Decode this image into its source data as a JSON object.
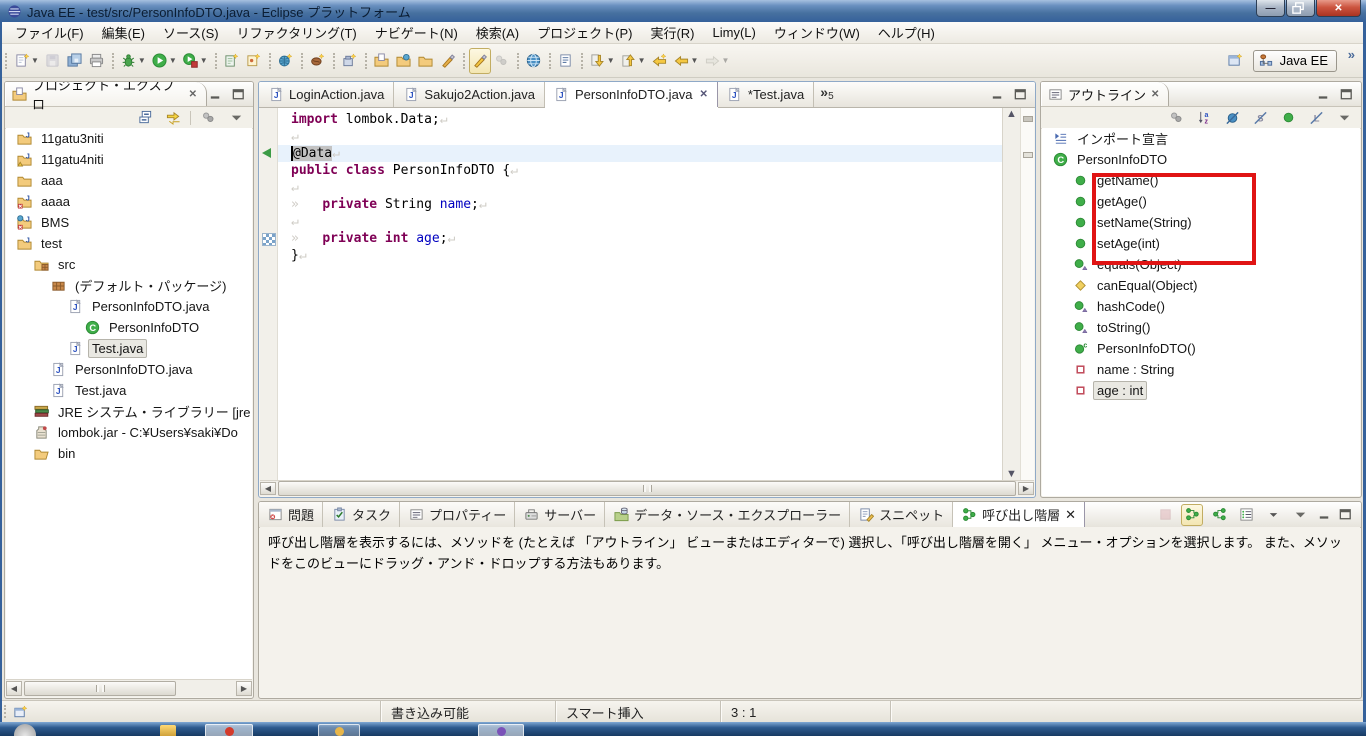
{
  "colors": {
    "annotation_red": "#e01414",
    "keyword": "#7f0055",
    "field_blue": "#0000c0",
    "current_line": "#e8f2fc",
    "selection_grey": "#c3c3c3"
  },
  "window": {
    "title": "Java EE - test/src/PersonInfoDTO.java - Eclipse プラットフォーム",
    "minimize": "—",
    "close": "x"
  },
  "menu": {
    "items": [
      "ファイル(F)",
      "編集(E)",
      "ソース(S)",
      "リファクタリング(T)",
      "ナビゲート(N)",
      "検索(A)",
      "プロジェクト(P)",
      "実行(R)",
      "Limy(L)",
      "ウィンドウ(W)",
      "ヘルプ(H)"
    ]
  },
  "toolbar": {
    "groups": [
      [
        {
          "name": "new-wizard",
          "icon": "new",
          "dd": true
        },
        {
          "name": "save",
          "icon": "save",
          "disabled": true
        },
        {
          "name": "save-all",
          "icon": "save-all"
        },
        {
          "name": "print",
          "icon": "print"
        }
      ],
      [
        {
          "name": "debug",
          "icon": "debug",
          "dd": true
        },
        {
          "name": "run",
          "icon": "run",
          "dd": true
        },
        {
          "name": "run-external-tools",
          "icon": "run-ext",
          "dd": true
        }
      ],
      [
        {
          "name": "new-servlet",
          "icon": "wiz-file"
        },
        {
          "name": "new-jsp",
          "icon": "wiz-page"
        }
      ],
      [
        {
          "name": "new-web-service",
          "icon": "wiz-globe"
        }
      ],
      [
        {
          "name": "new-ejb",
          "icon": "wiz-bean"
        }
      ],
      [
        {
          "name": "new-connector",
          "icon": "wiz-box"
        }
      ],
      [
        {
          "name": "open-type",
          "icon": "folder-doc"
        },
        {
          "name": "open-resource",
          "icon": "folder-globe"
        },
        {
          "name": "open-plugin",
          "icon": "folder-plain"
        },
        {
          "name": "format",
          "icon": "brush"
        }
      ],
      [
        {
          "name": "mark-occurrences",
          "icon": "highlighter",
          "toggled": true
        },
        {
          "name": "occurrence-filter",
          "icon": "dots",
          "disabled": true
        }
      ],
      [
        {
          "name": "web-browser",
          "icon": "globe"
        }
      ],
      [
        {
          "name": "task-list",
          "icon": "notes"
        }
      ],
      [
        {
          "name": "next-annotation",
          "icon": "arrow-down",
          "dd": true
        },
        {
          "name": "prev-annotation",
          "icon": "arrow-up",
          "dd": true
        },
        {
          "name": "last-edit-location",
          "icon": "back-star"
        },
        {
          "name": "back",
          "icon": "back",
          "dd": true
        },
        {
          "name": "forward",
          "icon": "forward",
          "disabled": true,
          "dd": true
        }
      ]
    ],
    "perspective": {
      "open_icon": "persp-open",
      "buttons": [
        {
          "icon": "persp-javaee",
          "label": "Java EE",
          "selected": true
        }
      ],
      "overflow": "»"
    }
  },
  "project_explorer": {
    "title": "プロジェクト・エクスプロ",
    "tools": [
      {
        "name": "collapse-all",
        "icon": "collapse-all"
      },
      {
        "name": "link-with-editor",
        "icon": "link-editor"
      },
      {
        "name": "sep",
        "icon": "sep"
      },
      {
        "name": "customize-view",
        "icon": "dots"
      },
      {
        "name": "view-menu",
        "icon": "viewmenu"
      }
    ],
    "items": [
      {
        "lvl": 0,
        "icon": "proj-j",
        "label": "11gatu3niti"
      },
      {
        "lvl": 0,
        "icon": "proj-warn",
        "label": "11gatu4niti"
      },
      {
        "lvl": 0,
        "icon": "folder",
        "label": "aaa"
      },
      {
        "lvl": 0,
        "icon": "proj-err",
        "label": "aaaa"
      },
      {
        "lvl": 0,
        "icon": "proj-bms",
        "label": "BMS"
      },
      {
        "lvl": 0,
        "icon": "proj-j",
        "label": "test"
      },
      {
        "lvl": 1,
        "icon": "src",
        "label": "src"
      },
      {
        "lvl": 2,
        "icon": "pkg",
        "label": "(デフォルト・パッケージ)"
      },
      {
        "lvl": 3,
        "icon": "jfile",
        "label": "PersonInfoDTO.java"
      },
      {
        "lvl": 4,
        "icon": "class",
        "label": "PersonInfoDTO"
      },
      {
        "lvl": 3,
        "icon": "jfile",
        "label": "Test.java",
        "selected": true
      },
      {
        "lvl": 2,
        "icon": "jfile",
        "label": "PersonInfoDTO.java"
      },
      {
        "lvl": 2,
        "icon": "jfile",
        "label": "Test.java"
      },
      {
        "lvl": 1,
        "icon": "lib",
        "label": "JRE システム・ライブラリー [jre"
      },
      {
        "lvl": 1,
        "icon": "jar",
        "label": "lombok.jar - C:¥Users¥saki¥Do"
      },
      {
        "lvl": 1,
        "icon": "folder-open",
        "label": "bin"
      }
    ]
  },
  "editor": {
    "tabs": [
      {
        "icon": "jfile",
        "label": "LoginAction.java"
      },
      {
        "icon": "jfile",
        "label": "Sakujo2Action.java"
      },
      {
        "icon": "jfile",
        "label": "PersonInfoDTO.java",
        "active": true,
        "closable": true
      },
      {
        "icon": "jfile",
        "label": "*Test.java"
      }
    ],
    "overflow": {
      "chevron": "»",
      "count": "5"
    },
    "code_lines": [
      {
        "segs": [
          {
            "t": "import ",
            "c": "kw"
          },
          {
            "t": "lombok.Data;",
            "c": "pl"
          },
          {
            "t": "↵",
            "c": "ws"
          }
        ]
      },
      {
        "segs": [
          {
            "t": "↵",
            "c": "ws"
          }
        ]
      },
      {
        "current": true,
        "segs": [
          {
            "t": "@Data",
            "c": "sel"
          },
          {
            "t": "↵",
            "c": "ws"
          }
        ]
      },
      {
        "segs": [
          {
            "t": "public class ",
            "c": "kw"
          },
          {
            "t": "PersonInfoDTO {",
            "c": "pl"
          },
          {
            "t": "↵",
            "c": "ws"
          }
        ]
      },
      {
        "segs": [
          {
            "t": "↵",
            "c": "ws"
          }
        ]
      },
      {
        "segs": [
          {
            "t": "»   ",
            "c": "ws"
          },
          {
            "t": "private ",
            "c": "kw"
          },
          {
            "t": "String ",
            "c": "pl"
          },
          {
            "t": "name",
            "c": "fl"
          },
          {
            "t": ";",
            "c": "pl"
          },
          {
            "t": "↵",
            "c": "ws"
          }
        ]
      },
      {
        "segs": [
          {
            "t": "↵",
            "c": "ws"
          }
        ]
      },
      {
        "segs": [
          {
            "t": "»   ",
            "c": "ws"
          },
          {
            "t": "private int ",
            "c": "kw"
          },
          {
            "t": "age",
            "c": "fl"
          },
          {
            "t": ";",
            "c": "pl"
          },
          {
            "t": "↵",
            "c": "ws"
          }
        ]
      },
      {
        "segs": [
          {
            "t": "}",
            "c": "pl"
          },
          {
            "t": "↵",
            "c": "ws"
          }
        ]
      }
    ],
    "gutter_markers": [
      {
        "line": 2,
        "type": "triangle"
      },
      {
        "line": 7,
        "type": "checker"
      }
    ]
  },
  "outline": {
    "title": "アウトライン",
    "tools": [
      {
        "name": "focus",
        "icon": "dots"
      },
      {
        "name": "sort",
        "icon": "sort-az"
      },
      {
        "name": "hide-fields",
        "icon": "hide-fields"
      },
      {
        "name": "hide-static",
        "icon": "hide-static"
      },
      {
        "name": "hide-non-public",
        "icon": "hide-nonpublic"
      },
      {
        "name": "hide-local-types",
        "icon": "hide-local"
      },
      {
        "name": "view-menu",
        "icon": "viewmenu"
      }
    ],
    "items": [
      {
        "lvl": 0,
        "icon": "imports",
        "label": "インポート宣言"
      },
      {
        "lvl": 0,
        "icon": "class",
        "label": "PersonInfoDTO"
      },
      {
        "lvl": 1,
        "icon": "pub",
        "label": "getName()"
      },
      {
        "lvl": 1,
        "icon": "pub",
        "label": "getAge()"
      },
      {
        "lvl": 1,
        "icon": "pub",
        "label": "setName(String)"
      },
      {
        "lvl": 1,
        "icon": "pub",
        "label": "setAge(int)"
      },
      {
        "lvl": 1,
        "icon": "pub-ovr",
        "label": "equals(Object)"
      },
      {
        "lvl": 1,
        "icon": "pro",
        "label": "canEqual(Object)"
      },
      {
        "lvl": 1,
        "icon": "pub-ovr",
        "label": "hashCode()"
      },
      {
        "lvl": 1,
        "icon": "pub-ovr",
        "label": "toString()"
      },
      {
        "lvl": 1,
        "icon": "ctor",
        "label": "PersonInfoDTO()"
      },
      {
        "lvl": 1,
        "icon": "pri-field",
        "label": "name : String"
      },
      {
        "lvl": 1,
        "icon": "pri-field",
        "label": "age : int",
        "selected": true
      }
    ]
  },
  "bottom_panel": {
    "tabs": [
      {
        "icon": "problems",
        "label": "問題"
      },
      {
        "icon": "tasks",
        "label": "タスク"
      },
      {
        "icon": "props",
        "label": "プロパティー"
      },
      {
        "icon": "servers",
        "label": "サーバー"
      },
      {
        "icon": "dse",
        "label": "データ・ソース・エクスプローラー"
      },
      {
        "icon": "snippets",
        "label": "スニペット"
      },
      {
        "icon": "callhier",
        "label": "呼び出し階層",
        "active": true,
        "closable": true
      }
    ],
    "tools": [
      {
        "name": "cancel",
        "icon": "stop",
        "disabled": true
      },
      {
        "name": "caller-hierarchy",
        "icon": "callers",
        "toggled": true
      },
      {
        "name": "callee-hierarchy",
        "icon": "callees"
      },
      {
        "name": "show-list",
        "icon": "listmode"
      },
      {
        "name": "history-dropdown",
        "icon": "dd-arrow"
      },
      {
        "name": "view-menu",
        "icon": "viewmenu"
      }
    ],
    "help_text": "呼び出し階層を表示するには、メソッドを (たとえば 「アウトライン」 ビューまたはエディターで) 選択し、「呼び出し階層を開く」 メニュー・オプションを選択します。 また、メソッドをこのビューにドラッグ・アンド・ドロップする方法もあります。"
  },
  "status_bar": {
    "writable": "書き込み可能",
    "insert_mode": "スマート挿入",
    "caret_position": "3 : 1"
  }
}
